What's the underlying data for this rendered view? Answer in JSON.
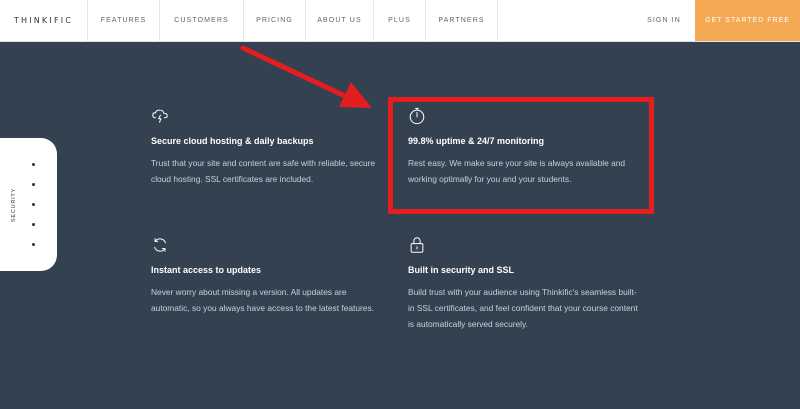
{
  "nav": {
    "logo": "THINKIFIC",
    "items": [
      "FEATURES",
      "CUSTOMERS",
      "PRICING",
      "ABOUT US",
      "PLUS",
      "PARTNERS"
    ],
    "sign_in": "SIGN IN",
    "cta": "GET STARTED FREE"
  },
  "side_nav": {
    "label": "SECURITY",
    "dot_count": 6
  },
  "features": [
    {
      "icon": "cloud-lightning-icon",
      "title": "Secure cloud hosting & daily backups",
      "description": "Trust that your site and content are safe with reliable, secure cloud hosting. SSL certificates are included."
    },
    {
      "icon": "stopwatch-icon",
      "title": "99.8% uptime & 24/7 monitoring",
      "description": "Rest easy. We make sure your site is always available and working optimally for you and your students."
    },
    {
      "icon": "refresh-icon",
      "title": "Instant access to updates",
      "description": "Never worry about missing a version. All updates are automatic, so you always have access to the latest features."
    },
    {
      "icon": "lock-icon",
      "title": "Built in security and SSL",
      "description": "Build trust with your audience using Thinkific's seamless built-in SSL certificates, and feel confident that your course content is automatically served securely."
    }
  ],
  "colors": {
    "background": "#334150",
    "cta": "#f4a955",
    "annotation": "#e41e1e"
  }
}
